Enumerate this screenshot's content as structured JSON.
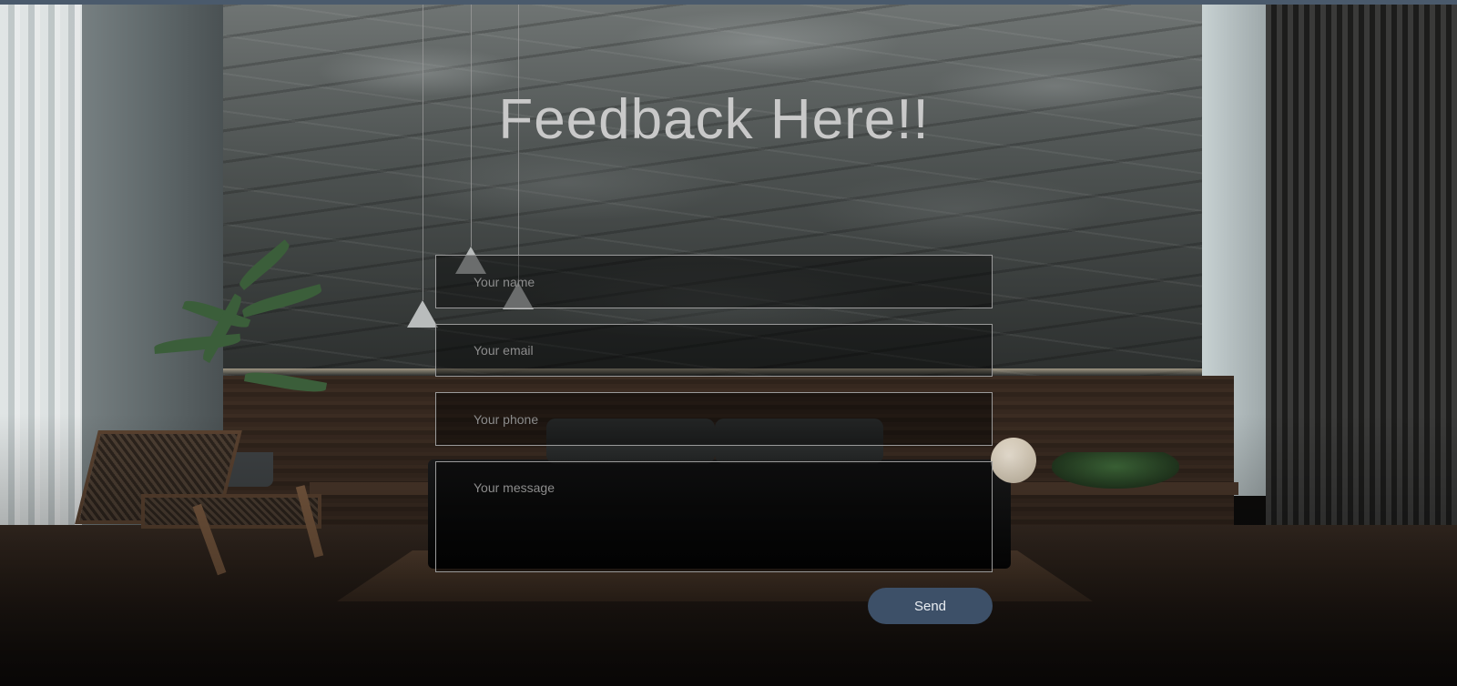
{
  "page": {
    "title": "Feedback Here!!"
  },
  "form": {
    "name_placeholder": "Your name",
    "email_placeholder": "Your email",
    "phone_placeholder": "Your phone",
    "message_placeholder": "Your message",
    "send_label": "Send"
  },
  "theme": {
    "accent": "#3d5068",
    "title_color": "#c9c9c9",
    "field_border": "#9a9a9a"
  }
}
